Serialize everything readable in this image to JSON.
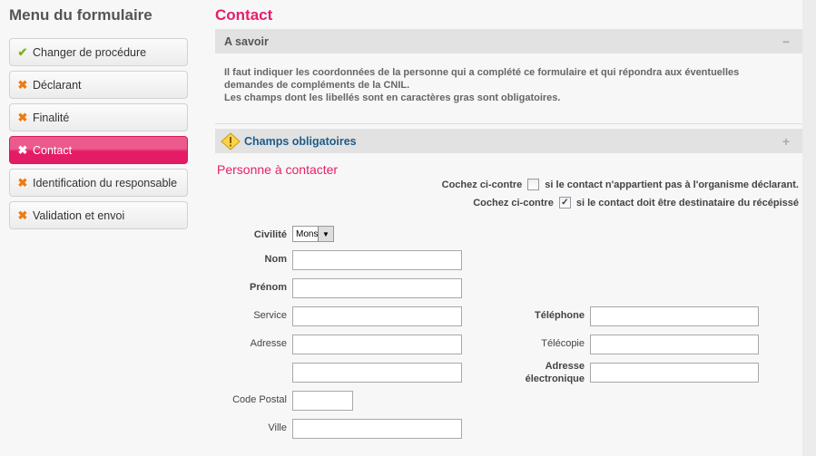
{
  "sidebar": {
    "title": "Menu du formulaire",
    "items": [
      {
        "label": "Changer de procédure",
        "status": "done",
        "icon": "check-icon"
      },
      {
        "label": "Déclarant",
        "status": "incomplete",
        "icon": "cross-icon"
      },
      {
        "label": "Finalité",
        "status": "incomplete",
        "icon": "cross-icon"
      },
      {
        "label": "Contact",
        "status": "active",
        "icon": "cross-icon"
      },
      {
        "label": "Identification du responsable",
        "status": "incomplete",
        "icon": "cross-icon"
      },
      {
        "label": "Validation et envoi",
        "status": "incomplete",
        "icon": "cross-icon"
      }
    ]
  },
  "main": {
    "title": "Contact",
    "info": {
      "title": "A savoir",
      "toggle": "−",
      "lines": [
        "Il faut indiquer les coordonnées de la personne qui a complété ce formulaire et qui répondra aux éventuelles",
        "demandes de compléments de la CNIL.",
        "Les champs dont les libellés sont en caractères gras sont obligatoires."
      ]
    },
    "required": {
      "title": "Champs obligatoires",
      "toggle": "+"
    },
    "section": "Personne à contacter",
    "checks": [
      {
        "prefix": "Cochez ci-contre",
        "suffix": "si le contact n'appartient pas à l'organisme déclarant.",
        "checked": false
      },
      {
        "prefix": "Cochez ci-contre",
        "suffix": "si le contact doit être destinataire du récépissé",
        "checked": true
      }
    ],
    "form": {
      "civilite_label": "Civilité",
      "civilite_value": "Monsieur",
      "nom": "Nom",
      "prenom": "Prénom",
      "service": "Service",
      "adresse": "Adresse",
      "code_postal": "Code Postal",
      "ville": "Ville",
      "telephone": "Téléphone",
      "telecopie": "Télécopie",
      "email_1": "Adresse",
      "email_2": "électronique"
    }
  },
  "colors": {
    "accent": "#e5206a",
    "ok": "#7ab51d",
    "ko": "#f07a12",
    "link": "#1e5b8a"
  }
}
